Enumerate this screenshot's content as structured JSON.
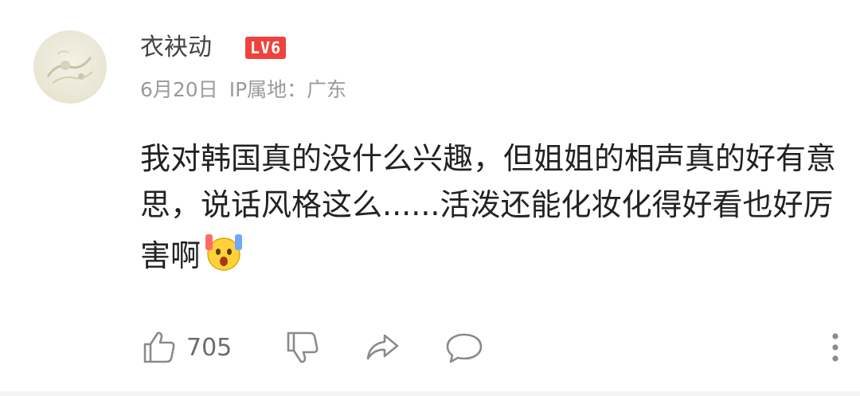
{
  "user": {
    "name": "衣袂动",
    "level": "LV6"
  },
  "meta": {
    "date": "6月20日",
    "ip_label": "IP属地：广东"
  },
  "comment": {
    "text": "我对韩国真的没什么兴趣，但姐姐的相声真的好有意思，说话风格这么......活泼还能化妆化得好看也好厉害啊",
    "emoji": "shocked-face-emoji"
  },
  "actions": {
    "like_count": "705"
  },
  "colors": {
    "level_badge": "#f0423c",
    "icon": "#8a8a8a"
  }
}
